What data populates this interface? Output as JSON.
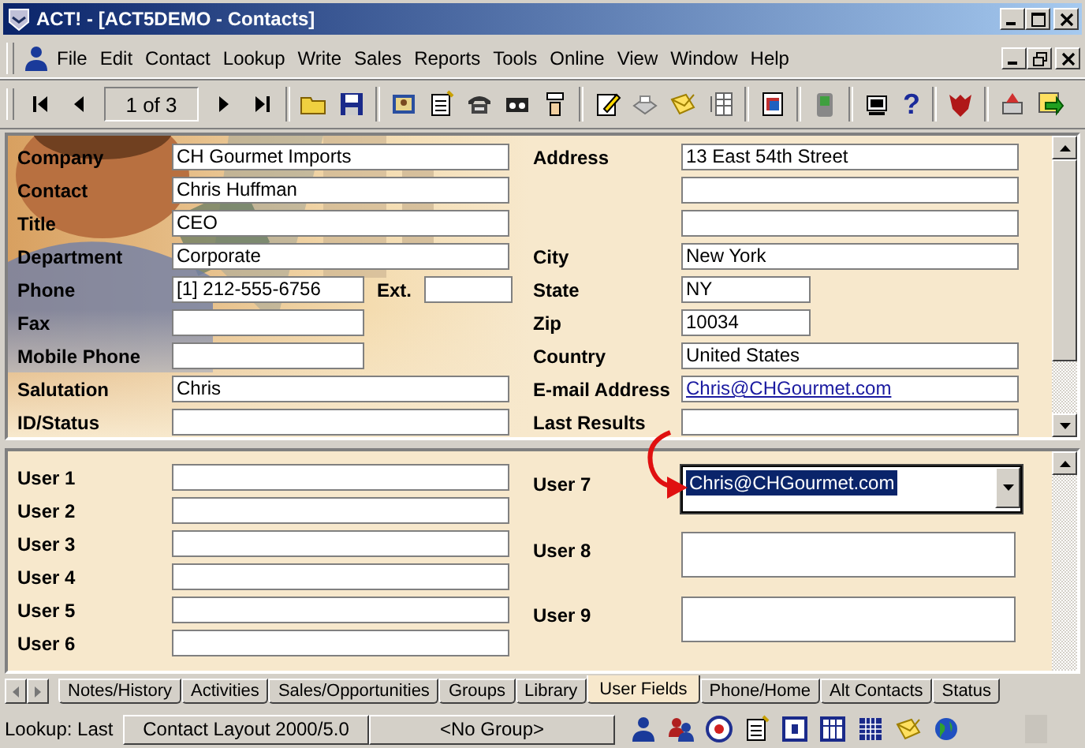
{
  "window": {
    "title": "ACT! - [ACT5DEMO - Contacts]"
  },
  "menu": [
    "File",
    "Edit",
    "Contact",
    "Lookup",
    "Write",
    "Sales",
    "Reports",
    "Tools",
    "Online",
    "View",
    "Window",
    "Help"
  ],
  "toolbar": {
    "record_counter": "1 of 3",
    "help_glyph": "?"
  },
  "contact_fields": {
    "left": [
      {
        "label": "Company",
        "value": "CH Gourmet Imports",
        "kind": "wide"
      },
      {
        "label": "Contact",
        "value": "Chris Huffman",
        "kind": "wide"
      },
      {
        "label": "Title",
        "value": "CEO",
        "kind": "wide"
      },
      {
        "label": "Department",
        "value": "Corporate",
        "kind": "wide"
      },
      {
        "label": "Phone",
        "value": "[1] 212-555-6756",
        "kind": "phone",
        "ext_label": "Ext."
      },
      {
        "label": "Fax",
        "kind": "short"
      },
      {
        "label": "Mobile Phone",
        "kind": "short"
      },
      {
        "label": "Salutation",
        "value": "Chris",
        "kind": "wide"
      },
      {
        "label": "ID/Status",
        "kind": "wide"
      }
    ],
    "right": [
      {
        "label": "Address",
        "value": "13 East 54th Street",
        "kind": "wide"
      },
      {
        "kind": "wide"
      },
      {
        "kind": "wide"
      },
      {
        "label": "City",
        "value": "New York",
        "kind": "wide"
      },
      {
        "label": "State",
        "value": "NY",
        "kind": "short"
      },
      {
        "label": "Zip",
        "value": "10034",
        "kind": "short"
      },
      {
        "label": "Country",
        "value": "United States",
        "kind": "wide"
      },
      {
        "label": "E-mail Address",
        "value": "Chris@CHGourmet.com",
        "kind": "link"
      },
      {
        "label": "Last Results",
        "kind": "wide"
      }
    ]
  },
  "user_fields": {
    "left": [
      {
        "label": "User 1"
      },
      {
        "label": "User 2"
      },
      {
        "label": "User 3"
      },
      {
        "label": "User 4"
      },
      {
        "label": "User 5"
      },
      {
        "label": "User 6"
      }
    ],
    "right": [
      {
        "label": "User 7",
        "value": "Chris@CHGourmet.com",
        "kind": "dropdown",
        "selected": true
      },
      {
        "label": "User 8",
        "kind": "memo",
        "selected": false
      },
      {
        "label": "User 9",
        "kind": "memo",
        "selected": false
      }
    ]
  },
  "tabs": [
    {
      "label": "Notes/History",
      "selected": false
    },
    {
      "label": "Activities",
      "selected": false
    },
    {
      "label": "Sales/Opportunities",
      "selected": false
    },
    {
      "label": "Groups",
      "selected": false
    },
    {
      "label": "Library",
      "selected": false
    },
    {
      "label": "User Fields",
      "selected": true
    },
    {
      "label": "Phone/Home",
      "selected": false
    },
    {
      "label": "Alt Contacts",
      "selected": false
    },
    {
      "label": "Status",
      "selected": false
    }
  ],
  "status_bar": {
    "lookup": "Lookup: Last",
    "layout": "Contact Layout 2000/5.0",
    "group": "<No Group>"
  }
}
